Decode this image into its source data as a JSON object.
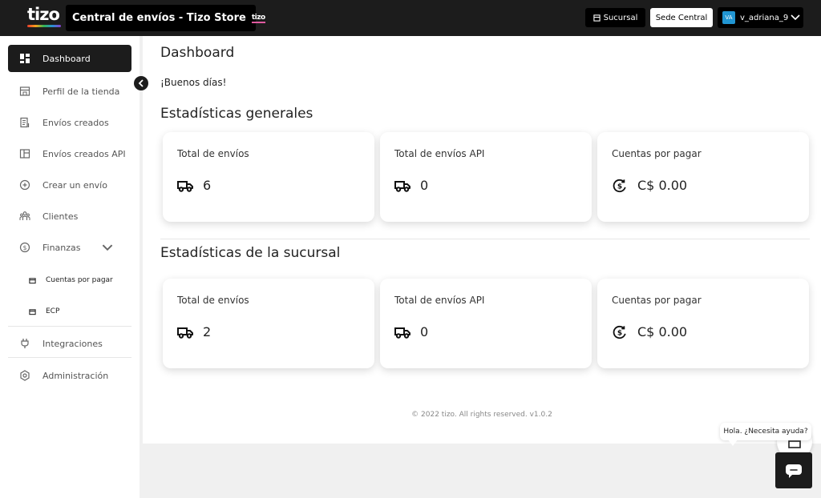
{
  "header": {
    "logo_text": "tizo",
    "title": "Central de envíos - Tizo Store",
    "title_mini_logo": "tizo",
    "sucursal_label": "Sucursal",
    "sede_label": "Sede Central",
    "user": {
      "initials": "VA",
      "name": "v_adriana_9"
    }
  },
  "sidebar": {
    "items": [
      {
        "label": "Dashboard",
        "icon": "dashboard-icon",
        "active": true
      },
      {
        "label": "Perfil de la tienda",
        "icon": "store-icon"
      },
      {
        "label": "Envíos creados",
        "icon": "document-list-icon"
      },
      {
        "label": "Envíos creados API",
        "icon": "api-window-icon"
      },
      {
        "label": "Crear un envío",
        "icon": "plus-circle-icon"
      },
      {
        "label": "Clientes",
        "icon": "users-icon"
      },
      {
        "label": "Finanzas",
        "icon": "dollar-coin-icon",
        "expanded": true
      },
      {
        "label": "Integraciones",
        "icon": "plug-icon"
      },
      {
        "label": "Administración",
        "icon": "settings-icon"
      }
    ],
    "sub_items": [
      {
        "label": "Cuentas por pagar",
        "icon": "wallet-icon"
      },
      {
        "label": "ECP",
        "icon": "wallet-icon"
      }
    ]
  },
  "main": {
    "page_title": "Dashboard",
    "greeting": "¡Buenos días!",
    "general": {
      "title": "Estadísticas generales",
      "cards": [
        {
          "label": "Total de envíos",
          "value": "6",
          "icon": "truck-icon"
        },
        {
          "label": "Total de envíos API",
          "value": "0",
          "icon": "truck-icon"
        },
        {
          "label": "Cuentas por pagar",
          "value": "C$ 0.00",
          "icon": "dollar-cycle-icon"
        }
      ]
    },
    "branch": {
      "title": "Estadísticas de la sucursal",
      "cards": [
        {
          "label": "Total de envíos",
          "value": "2",
          "icon": "truck-icon"
        },
        {
          "label": "Total de envíos API",
          "value": "0",
          "icon": "truck-icon"
        },
        {
          "label": "Cuentas por pagar",
          "value": "C$ 0.00",
          "icon": "dollar-cycle-icon"
        }
      ]
    },
    "footer": "© 2022 tizo. All rights reserved. v1.0.2"
  },
  "chat": {
    "bubble_text": "Hola. ¿Necesita ayuda?"
  },
  "colors": {
    "dark": "#1c1c1c",
    "accent_blue": "#2196d3",
    "page_bg": "#f0f0f0"
  }
}
